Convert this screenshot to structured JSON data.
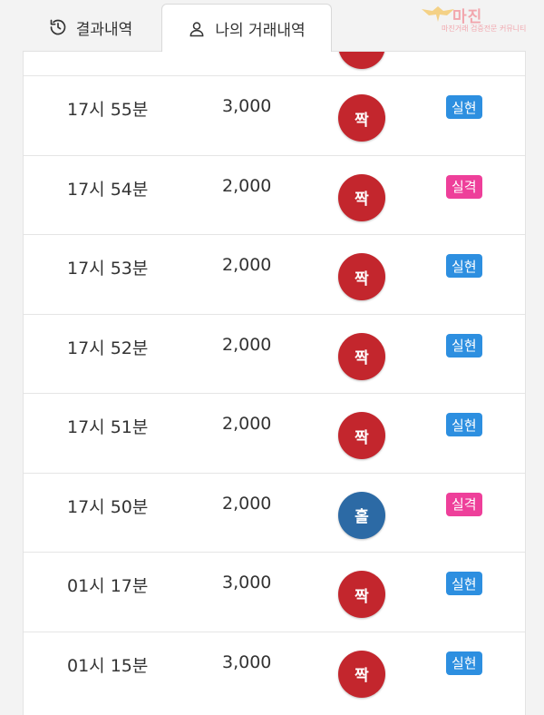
{
  "tabs": {
    "results_label": "결과내역",
    "mine_label": "나의 거래내역"
  },
  "watermark": {
    "text": "마진",
    "subtext": "마진거래 검증전문 커뮤니티"
  },
  "colors": {
    "even_chip": "#c3262d",
    "odd_chip": "#2c6aa5",
    "win_badge": "#2d8fe0",
    "lose_badge": "#ee3f9a"
  },
  "rows": [
    {
      "time": "17시 55분",
      "amount": "3,000",
      "pick": "짝",
      "result": "실현"
    },
    {
      "time": "17시 54분",
      "amount": "2,000",
      "pick": "짝",
      "result": "실격"
    },
    {
      "time": "17시 53분",
      "amount": "2,000",
      "pick": "짝",
      "result": "실현"
    },
    {
      "time": "17시 52분",
      "amount": "2,000",
      "pick": "짝",
      "result": "실현"
    },
    {
      "time": "17시 51분",
      "amount": "2,000",
      "pick": "짝",
      "result": "실현"
    },
    {
      "time": "17시 50분",
      "amount": "2,000",
      "pick": "홀",
      "result": "실격"
    },
    {
      "time": "01시 17분",
      "amount": "3,000",
      "pick": "짝",
      "result": "실현"
    },
    {
      "time": "01시 15분",
      "amount": "3,000",
      "pick": "짝",
      "result": "실현"
    }
  ]
}
